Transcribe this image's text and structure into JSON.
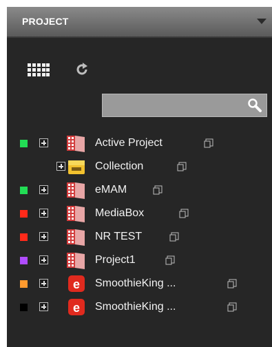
{
  "panel": {
    "title": "PROJECT"
  },
  "search": {
    "placeholder": "",
    "value": ""
  },
  "icons": {
    "grid": "grid-view-icon",
    "refresh": "refresh-icon",
    "search": "search-icon",
    "expand": "expand-plus-icon",
    "popout": "popout-window-icon",
    "project": "project-book-icon",
    "collection": "collection-box-icon",
    "ebrand": "e-brand-icon"
  },
  "tree": {
    "items": [
      {
        "label": "Active Project",
        "status_color": "#22dd55",
        "icon": "project-book-icon"
      },
      {
        "label": "Collection",
        "status_color": "",
        "icon": "collection-box-icon"
      },
      {
        "label": "eMAM",
        "status_color": "#22dd55",
        "icon": "project-book-icon"
      },
      {
        "label": "MediaBox",
        "status_color": "#ff2a1a",
        "icon": "project-book-icon"
      },
      {
        "label": "NR TEST",
        "status_color": "#ff2a1a",
        "icon": "project-book-icon"
      },
      {
        "label": "Project1",
        "status_color": "#b04cff",
        "icon": "project-book-icon"
      },
      {
        "label": "SmoothieKing ...",
        "status_color": "#ff9a2e",
        "icon": "e-brand-icon"
      },
      {
        "label": "SmoothieKing ...",
        "status_color": "#000000",
        "icon": "e-brand-icon"
      }
    ]
  }
}
